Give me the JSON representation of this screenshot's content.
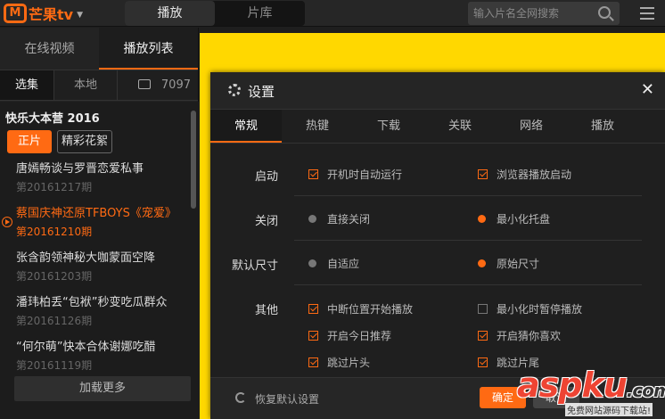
{
  "app": {
    "logo_box": "M",
    "logo_text": "芒果tv",
    "main_tabs": [
      "播放",
      "片库"
    ],
    "search_placeholder": "输入片名全网搜索"
  },
  "sidebar": {
    "tabs": [
      "在线视频",
      "播放列表"
    ],
    "subtabs": [
      "选集",
      "本地",
      "7097"
    ],
    "show_title": "快乐大本营 2016",
    "chips": [
      "正片",
      "精彩花絮"
    ],
    "items": [
      {
        "name": "唐嫣畅谈与罗晋恋爱私事",
        "period": "第20161217期"
      },
      {
        "name": "蔡国庆神还原TFBOYS《宠爱》",
        "period": "第20161210期"
      },
      {
        "name": "张含韵领神秘大咖蒙面空降",
        "period": "第20161203期"
      },
      {
        "name": "潘玮柏丢“包袱”秒变吃瓜群众",
        "period": "第20161126期"
      },
      {
        "name": "“何尔萌”快本合体谢娜吃醋",
        "period": "第20161119期"
      }
    ],
    "active_index": 1,
    "load_more": "加载更多"
  },
  "colors": {
    "accent": "#ff6a13",
    "video_bg": "#ffd800"
  },
  "settings": {
    "title": "设置",
    "close": "✕",
    "tabs": [
      "常规",
      "热键",
      "下载",
      "关联",
      "网络",
      "播放"
    ],
    "rows": {
      "startup": {
        "label": "启动",
        "opt1": "开机时自动运行",
        "opt2": "浏览器播放启动"
      },
      "close": {
        "label": "关闭",
        "opt1": "直接关闭",
        "opt2": "最小化托盘",
        "selected": "最小化托盘"
      },
      "size": {
        "label": "默认尺寸",
        "opt1": "自适应",
        "opt2": "原始尺寸",
        "selected": "原始尺寸"
      },
      "other": {
        "label": "其他",
        "opts": [
          "中断位置开始播放",
          "最小化时暂停播放",
          "开启今日推荐",
          "开启猜你喜欢",
          "跳过片头",
          "跳过片尾"
        ],
        "checked": [
          true,
          false,
          true,
          true,
          true,
          true
        ]
      }
    },
    "reset": "恢复默认设置",
    "ok": "确定",
    "cancel": "取消"
  },
  "watermark": {
    "big_a": "asp",
    "big_b": "ku",
    "big_c": ".com",
    "small": "免费网站源码下载站!"
  }
}
